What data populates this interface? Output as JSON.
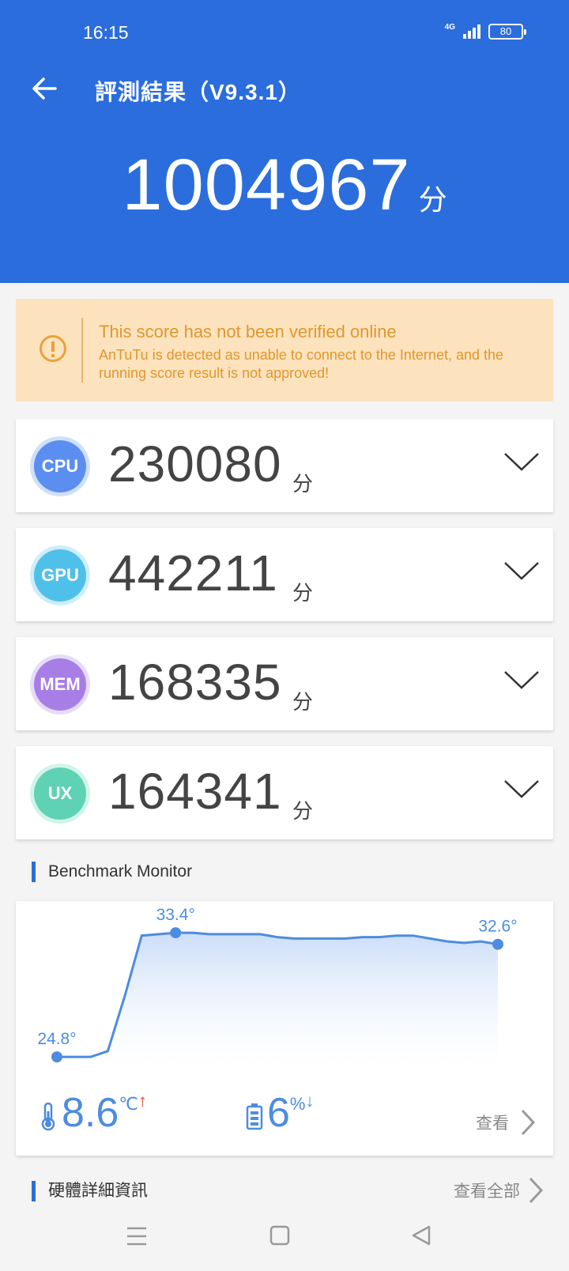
{
  "status": {
    "time": "16:15",
    "network": "4G",
    "battery": "80"
  },
  "header": {
    "title": "評測結果（V9.3.1）",
    "total_score": "1004967",
    "unit": "分"
  },
  "warning": {
    "title": "This score has not been verified online",
    "message": "AnTuTu is detected as unable to connect to the Internet, and the running score result is not approved!"
  },
  "scores": [
    {
      "label": "CPU",
      "value": "230080",
      "unit": "分",
      "color": "#5b8ef0",
      "ring": "#cfe0fb"
    },
    {
      "label": "GPU",
      "value": "442211",
      "unit": "分",
      "color": "#4fc0ea",
      "ring": "#cdeefa"
    },
    {
      "label": "MEM",
      "value": "168335",
      "unit": "分",
      "color": "#a77ee6",
      "ring": "#e7dcf8"
    },
    {
      "label": "UX",
      "value": "164341",
      "unit": "分",
      "color": "#5fd2b4",
      "ring": "#d2f4ea"
    }
  ],
  "monitor": {
    "section_title": "Benchmark Monitor",
    "start_label": "24.8°",
    "peak_label": "33.4°",
    "end_label": "32.6°",
    "temp_delta": "8.6",
    "temp_unit": "℃",
    "temp_arrow": "↑",
    "battery_delta": "6",
    "battery_unit": "%",
    "battery_arrow": "↓",
    "view_label": "查看"
  },
  "chart_data": {
    "type": "area",
    "title": "",
    "y": [
      24.8,
      24.8,
      24.8,
      25.2,
      29.0,
      33.2,
      33.3,
      33.4,
      33.4,
      33.3,
      33.3,
      33.3,
      33.3,
      33.1,
      33.0,
      33.0,
      33.0,
      33.0,
      33.1,
      33.1,
      33.2,
      33.2,
      33.0,
      32.8,
      32.7,
      32.8,
      32.6
    ],
    "labeled_points": [
      {
        "index": 0,
        "label": "24.8°"
      },
      {
        "index": 7,
        "label": "33.4°"
      },
      {
        "index": 26,
        "label": "32.6°"
      }
    ],
    "ylim": [
      23,
      34.5
    ],
    "grid": false,
    "colors": {
      "line": "#4d8ce0",
      "fill": "#d8e6fa"
    }
  },
  "hardware": {
    "section_title": "硬體詳細資訊",
    "view_all": "查看全部"
  }
}
